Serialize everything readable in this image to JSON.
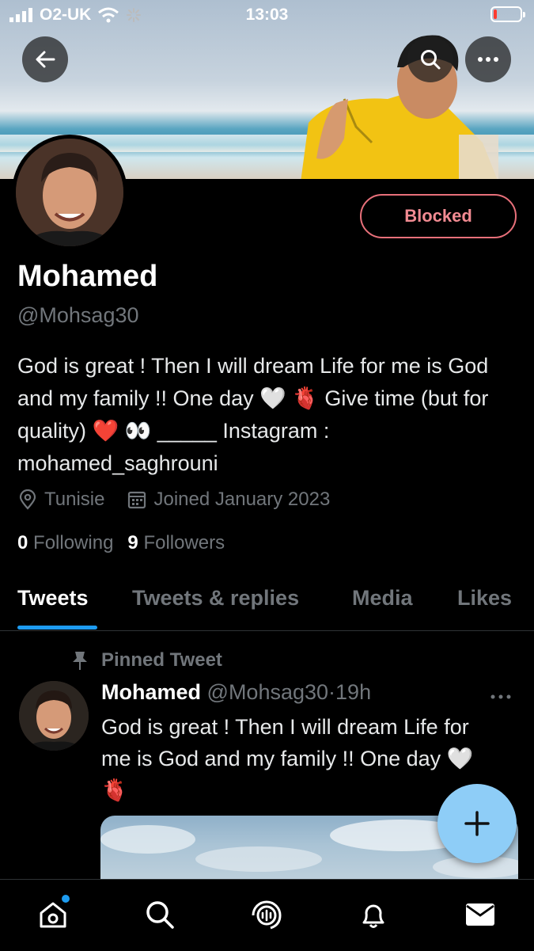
{
  "status_bar": {
    "carrier": "O2-UK",
    "time": "13:03"
  },
  "profile": {
    "name": "Mohamed",
    "handle": "@Mohsag30",
    "relationship_button": "Blocked",
    "bio": "God is great ! Then I will dream Life for me is God and my family !! One day 🤍 🫀 Give time (but for quality) ❤️ 👀 _____ Instagram : mohamed_saghrouni",
    "location": "Tunisie",
    "joined": "Joined January 2023",
    "following_count": "0",
    "following_label": "Following",
    "followers_count": "9",
    "followers_label": "Followers"
  },
  "tabs": [
    {
      "label": "Tweets",
      "active": true
    },
    {
      "label": "Tweets & replies",
      "active": false
    },
    {
      "label": "Media",
      "active": false
    },
    {
      "label": "Likes",
      "active": false
    }
  ],
  "pinned_tweet": {
    "pinned_label": "Pinned Tweet",
    "author_name": "Mohamed",
    "author_handle": "@Mohsag30",
    "separator": "·",
    "time": "19h",
    "text": "God is great !  Then I will dream Life for me is God and my family !! One day 🤍 🫀"
  },
  "icons": {
    "back": "arrow-left-icon",
    "search": "search-icon",
    "more": "more-horizontal-icon",
    "location": "location-pin-icon",
    "calendar": "calendar-icon",
    "pin": "pin-icon",
    "compose": "plus-icon",
    "nav": [
      "home-icon",
      "search-icon",
      "spaces-icon",
      "bell-icon",
      "mail-icon"
    ]
  },
  "colors": {
    "background": "#000000",
    "accent": "#1d9bf0",
    "blocked": "#f4212e",
    "secondary_text": "#71767b",
    "fab": "#8ecdf7"
  }
}
